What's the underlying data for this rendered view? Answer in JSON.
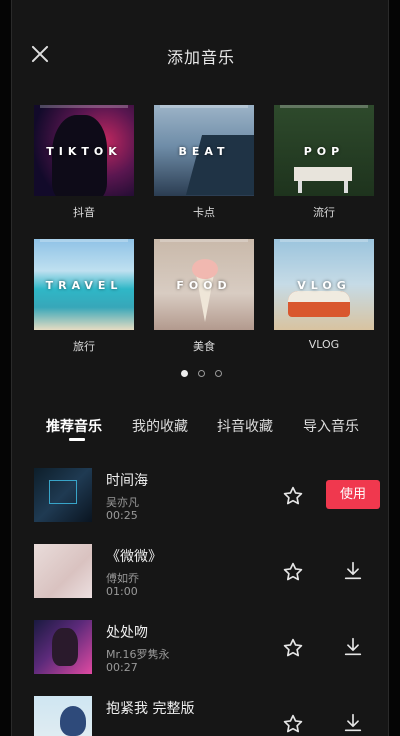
{
  "header": {
    "title": "添加音乐"
  },
  "categories": [
    {
      "cover_text": "TIKTOK",
      "label": "抖音"
    },
    {
      "cover_text": "BEAT",
      "label": "卡点"
    },
    {
      "cover_text": "POP",
      "label": "流行"
    },
    {
      "cover_text": "TRAVEL",
      "label": "旅行"
    },
    {
      "cover_text": "FOOD",
      "label": "美食"
    },
    {
      "cover_text": "VLOG",
      "label": "VLOG"
    }
  ],
  "pager": {
    "pages": 3,
    "active": 1
  },
  "tabs": [
    "推荐音乐",
    "我的收藏",
    "抖音收藏",
    "导入音乐"
  ],
  "songs": [
    {
      "name": "时间海",
      "artist": "吴亦凡",
      "duration": "00:25",
      "action": "使用"
    },
    {
      "name": "《微微》",
      "artist": "傅如乔",
      "duration": "01:00"
    },
    {
      "name": "处处吻",
      "artist": "Mr.16罗隽永",
      "duration": "00:27"
    },
    {
      "name": "抱紧我 完整版",
      "artist": "",
      "duration": ""
    }
  ],
  "icons": {
    "close": "close-icon",
    "favorite": "star-outline-icon",
    "download": "download-icon"
  },
  "colors": {
    "accent": "#f0384e",
    "background": "#161616"
  }
}
